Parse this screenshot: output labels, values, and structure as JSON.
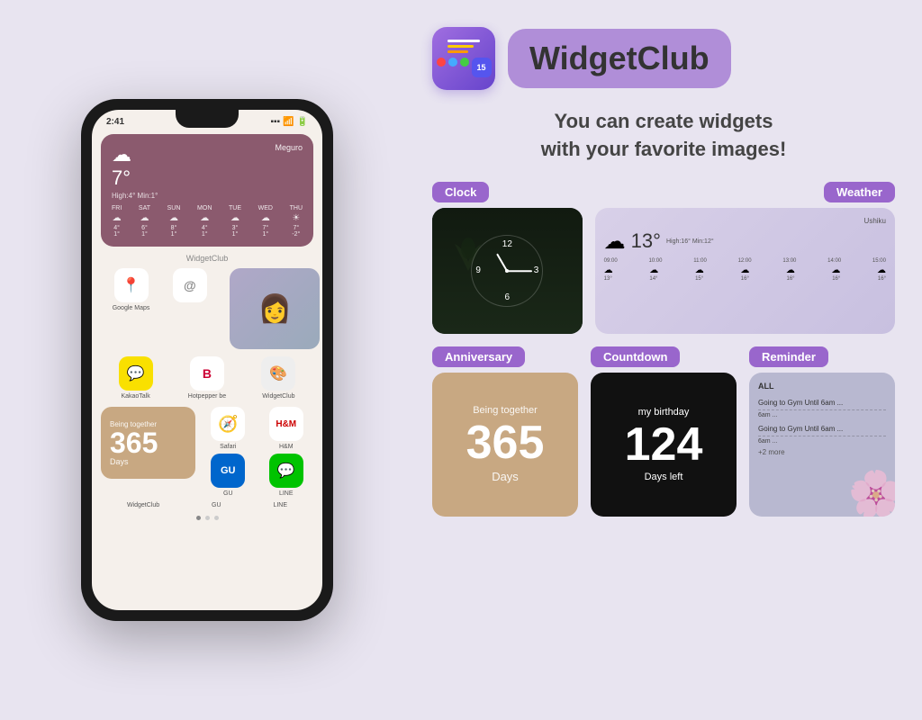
{
  "app": {
    "name": "WidgetClub",
    "tagline_line1": "You can create widgets",
    "tagline_line2": "with your favorite images!"
  },
  "phone": {
    "time": "2:41",
    "weather_widget": {
      "temp": "7°",
      "location": "Meguro",
      "high_min": "High:4° Min:1°",
      "days": [
        {
          "label": "FRI",
          "icon": "☁",
          "high": "4°",
          "low": "1°"
        },
        {
          "label": "SAT",
          "icon": "☁",
          "high": "6°",
          "low": "1°"
        },
        {
          "label": "SUN",
          "icon": "☁",
          "high": "8°",
          "low": "1°"
        },
        {
          "label": "MON",
          "icon": "☁",
          "high": "4°",
          "low": "1°"
        },
        {
          "label": "TUE",
          "icon": "☁",
          "high": "3°",
          "low": "1°"
        },
        {
          "label": "WED",
          "icon": "☁",
          "high": "7°",
          "low": "1°"
        },
        {
          "label": "THU",
          "icon": "☀",
          "high": "7°",
          "low": "-2°"
        }
      ]
    },
    "widgetclub_label": "WidgetClub",
    "app_icons_row": [
      {
        "label": "Google Maps",
        "icon": "📍",
        "bg": "#fff"
      },
      {
        "label": "",
        "icon": "@",
        "bg": "#fff"
      }
    ],
    "second_row": {
      "app_icons": [
        {
          "label": "KakaoTalk",
          "icon": "💬",
          "bg": "#f9e000"
        },
        {
          "label": "Hotpepper be",
          "icon": "B",
          "bg": "#fff"
        },
        {
          "label": "WidgetClub",
          "icon": "🎨",
          "bg": "#fff"
        }
      ]
    },
    "anniversary_widget": {
      "being_together": "Being together",
      "number": "365",
      "days": "Days"
    },
    "bottom_icons": [
      {
        "label": "WidgetClub",
        "icon": "🎨"
      },
      {
        "label": "GU",
        "icon": "GU"
      },
      {
        "label": "LINE",
        "icon": "💬"
      }
    ]
  },
  "widgets": {
    "clock": {
      "label": "Clock",
      "number": "12",
      "hour_marker_3": "3",
      "hour_marker_6": "6",
      "hour_marker_9": "9"
    },
    "weather": {
      "label": "Weather",
      "location": "Ushiku",
      "temp": "13°",
      "high_min": "High:16° Min:12°",
      "times": [
        "09:00",
        "10:00",
        "11:00",
        "12:00",
        "13:00",
        "14:00",
        "15:00"
      ],
      "icons": [
        "☁",
        "☁",
        "☁",
        "☁",
        "☁",
        "☁",
        "☁"
      ],
      "temps": [
        "13°",
        "14°",
        "15°",
        "16°",
        "16°",
        "16°",
        "16°"
      ]
    },
    "anniversary": {
      "label": "Anniversary",
      "being_together": "Being together",
      "number": "365",
      "days": "Days"
    },
    "countdown": {
      "label": "Countdown",
      "my_birthday": "my birthday",
      "number": "124",
      "days_left": "Days left"
    },
    "reminder": {
      "label": "Reminder",
      "title": "ALL",
      "items": [
        "Going to Gym Until 6am ...",
        "Going to Gym Until 6am ..."
      ],
      "more": "+2 more"
    }
  }
}
